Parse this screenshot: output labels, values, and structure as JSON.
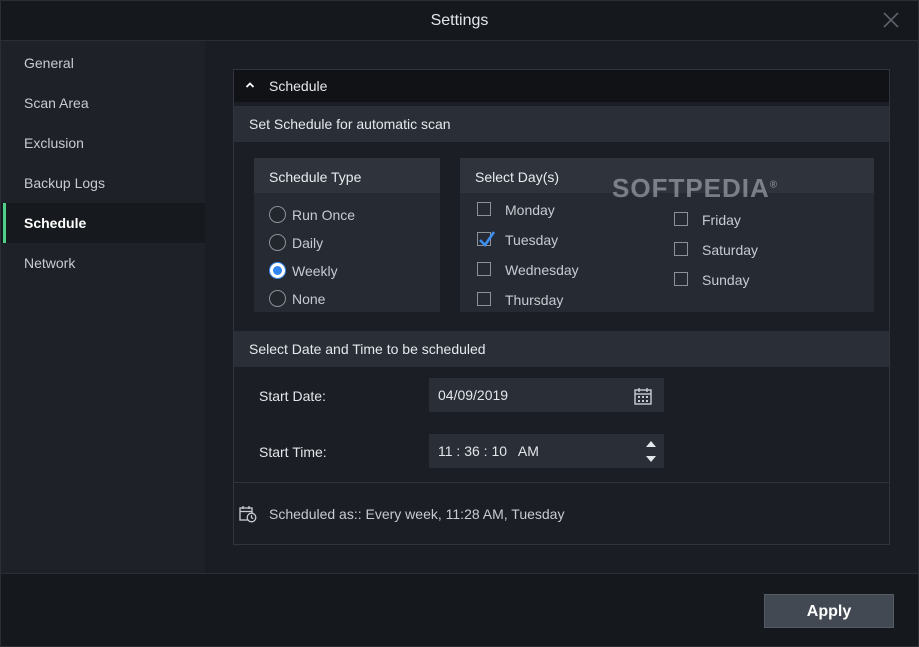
{
  "window": {
    "title": "Settings"
  },
  "sidebar": {
    "items": [
      {
        "label": "General"
      },
      {
        "label": "Scan Area"
      },
      {
        "label": "Exclusion"
      },
      {
        "label": "Backup Logs"
      },
      {
        "label": "Schedule",
        "active": true
      },
      {
        "label": "Network"
      }
    ]
  },
  "panel": {
    "title": "Schedule",
    "section1": "Set Schedule for automatic scan",
    "schedule_type": {
      "title": "Schedule Type",
      "options": [
        "Run Once",
        "Daily",
        "Weekly",
        "None"
      ],
      "selected": "Weekly"
    },
    "select_days": {
      "title": "Select Day(s)",
      "days": [
        {
          "label": "Monday",
          "checked": false
        },
        {
          "label": "Tuesday",
          "checked": true
        },
        {
          "label": "Wednesday",
          "checked": false
        },
        {
          "label": "Thursday",
          "checked": false
        },
        {
          "label": "Friday",
          "checked": false
        },
        {
          "label": "Saturday",
          "checked": false
        },
        {
          "label": "Sunday",
          "checked": false
        }
      ]
    },
    "section2": "Select Date and Time to be scheduled",
    "start_date": {
      "label": "Start Date:",
      "value": "04/09/2019"
    },
    "start_time": {
      "label": "Start Time:",
      "value": "11 : 36 : 10   AM"
    },
    "scheduled_as": "Scheduled as:: Every week, 11:28 AM, Tuesday"
  },
  "watermark": "SOFTPEDIA",
  "footer": {
    "apply_label": "Apply"
  },
  "colors": {
    "accent": "#4fd08a",
    "radio_selected": "#2f86f0",
    "check": "#3d8ef0"
  }
}
